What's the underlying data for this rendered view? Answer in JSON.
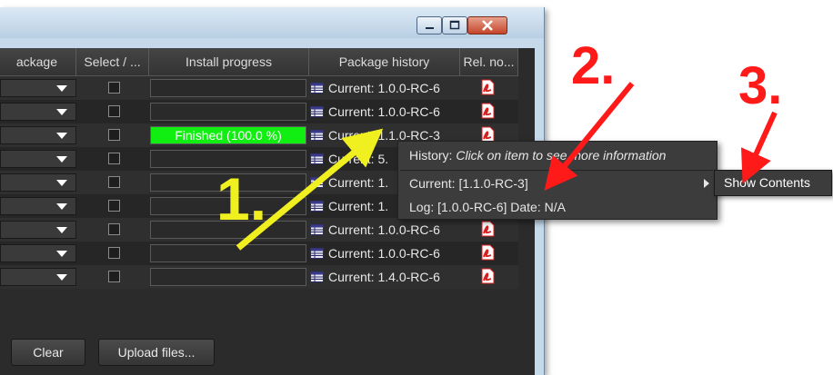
{
  "table": {
    "headers": [
      "ackage",
      "Select / ...",
      "Install progress",
      "Package history",
      "Rel. no..."
    ],
    "rows": [
      {
        "history": "Current: 1.0.0-RC-6"
      },
      {
        "history": "Current: 1.0.0-RC-6"
      },
      {
        "history": "Current: 1.1.0-RC-3",
        "progress": 1.0,
        "progress_label": "Finished (100.0 %)"
      },
      {
        "history": "Current: 5."
      },
      {
        "history": "Current: 1."
      },
      {
        "history": "Current: 1."
      },
      {
        "history": "Current: 1.0.0-RC-6"
      },
      {
        "history": "Current: 1.0.0-RC-6"
      },
      {
        "history": "Current: 1.4.0-RC-6"
      }
    ]
  },
  "buttons": {
    "clear": "Clear",
    "upload": "Upload files..."
  },
  "context_menu": {
    "history_prefix": "History: ",
    "history_hint": "Click on item to see more information",
    "current": "Current: [1.1.0-RC-3]",
    "log": "Log: [1.0.0-RC-6] Date: N/A"
  },
  "submenu": {
    "show_contents": "Show Contents"
  },
  "callouts": {
    "one": "1.",
    "two": "2.",
    "three": "3."
  },
  "colors": {
    "progress_fill": "#11ee11",
    "callout_yellow": "#f0f020",
    "callout_red": "#ff1a1a",
    "pdf_red": "#d42020"
  },
  "icons": [
    "minimize-icon",
    "maximize-icon",
    "close-icon",
    "dropdown-arrow-icon",
    "history-table-icon",
    "pdf-icon",
    "submenu-arrow-icon"
  ]
}
